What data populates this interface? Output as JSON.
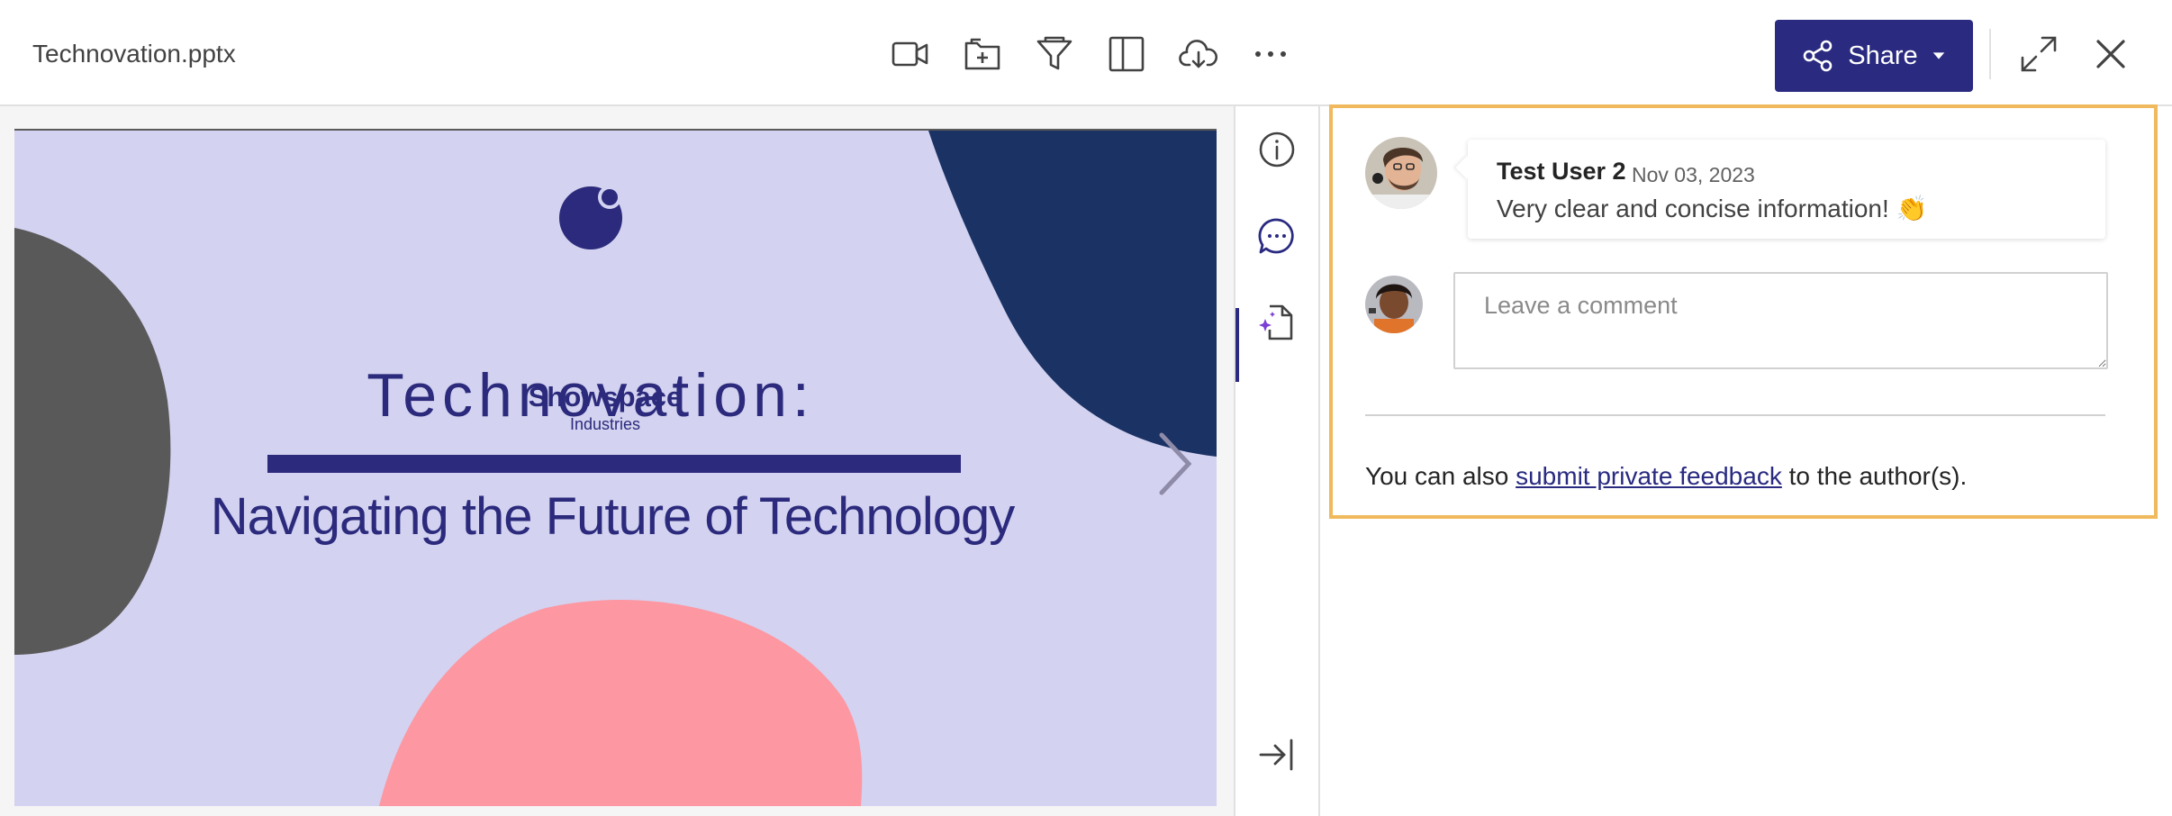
{
  "header": {
    "filename": "Technovation.pptx",
    "toolbar_icons": [
      "video-camera-icon",
      "folder-add-icon",
      "funnel-icon",
      "panel-layout-icon",
      "cloud-download-icon",
      "more-horizontal-icon"
    ],
    "share_label": "Share",
    "accent_color": "#292a80"
  },
  "slide": {
    "brand_name": "Showspace",
    "brand_sub": "Industries",
    "title": "Technovation:",
    "subtitle": "Navigating the Future of Technology",
    "colors": {
      "background": "#d3d2f0",
      "navy": "#1b3264",
      "gray": "#595959",
      "pink": "#fd97a2",
      "text": "#2b2a7c"
    }
  },
  "rail": {
    "icons": [
      "info-icon",
      "comments-icon",
      "document-sparkle-icon",
      "collapse-panel-icon"
    ],
    "active": "comments-icon"
  },
  "comments": {
    "items": [
      {
        "author": "Test User 2",
        "date": "Nov 03, 2023",
        "text": "Very clear and concise information!",
        "emoji": "👏"
      }
    ],
    "input_placeholder": "Leave a comment",
    "private_prefix": "You can also",
    "private_link": "submit private feedback",
    "private_suffix": "to the author(s).",
    "highlight_color": "#f0b95d"
  }
}
